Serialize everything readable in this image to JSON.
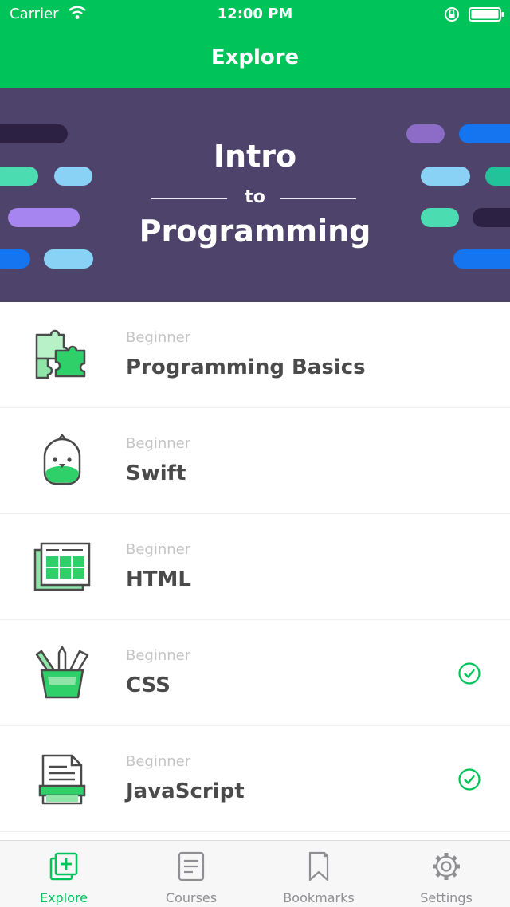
{
  "status_bar": {
    "carrier": "Carrier",
    "time": "12:00 PM"
  },
  "nav": {
    "title": "Explore"
  },
  "hero": {
    "line1": "Intro",
    "line2": "to",
    "line3": "Programming"
  },
  "courses": [
    {
      "level": "Beginner",
      "name": "Programming Basics",
      "icon": "puzzle-icon",
      "completed": false
    },
    {
      "level": "Beginner",
      "name": "Swift",
      "icon": "swift-bird-icon",
      "completed": false
    },
    {
      "level": "Beginner",
      "name": "HTML",
      "icon": "html-window-icon",
      "completed": false
    },
    {
      "level": "Beginner",
      "name": "CSS",
      "icon": "pencil-cup-icon",
      "completed": true
    },
    {
      "level": "Beginner",
      "name": "JavaScript",
      "icon": "document-icon",
      "completed": true
    }
  ],
  "tabs": [
    {
      "label": "Explore",
      "icon": "explore-icon",
      "active": true
    },
    {
      "label": "Courses",
      "icon": "courses-icon",
      "active": false
    },
    {
      "label": "Bookmarks",
      "icon": "bookmark-icon",
      "active": false
    },
    {
      "label": "Settings",
      "icon": "gear-icon",
      "active": false
    }
  ],
  "colors": {
    "brand_green": "#00c35a",
    "hero_bg": "#4e436a",
    "text_dark": "#4a4a4a",
    "text_muted": "#c4c4c4",
    "tab_inactive": "#8e8e93"
  }
}
